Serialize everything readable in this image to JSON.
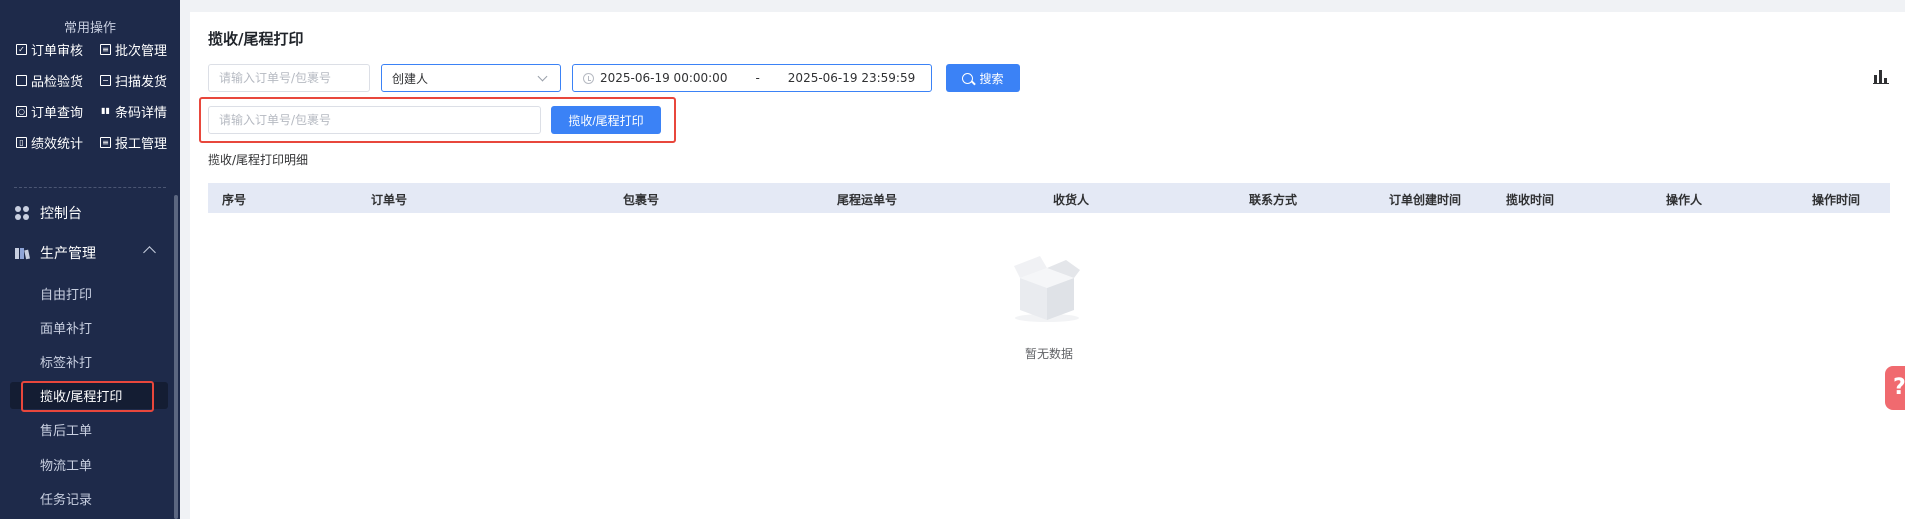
{
  "sidebar": {
    "quick_title": "常用操作",
    "quick_items": [
      {
        "label": "订单审核",
        "icon": "check-square-icon"
      },
      {
        "label": "批次管理",
        "icon": "batch-icon"
      },
      {
        "label": "品检验货",
        "icon": "inspect-icon"
      },
      {
        "label": "扫描发货",
        "icon": "scan-icon"
      },
      {
        "label": "订单查询",
        "icon": "order-query-icon"
      },
      {
        "label": "条码详情",
        "icon": "barcode-icon"
      },
      {
        "label": "绩效统计",
        "icon": "stats-icon"
      },
      {
        "label": "报工管理",
        "icon": "report-icon"
      }
    ],
    "console_label": "控制台",
    "production_label": "生产管理",
    "sub_items": [
      {
        "label": "自由打印"
      },
      {
        "label": "面单补打"
      },
      {
        "label": "标签补打"
      },
      {
        "label": "揽收/尾程打印"
      },
      {
        "label": "售后工单"
      },
      {
        "label": "物流工单"
      },
      {
        "label": "任务记录"
      }
    ]
  },
  "main": {
    "title": "揽收/尾程打印",
    "filters": {
      "order_input_placeholder": "请输入订单号/包裹号",
      "creator_value": "创建人",
      "date_start": "2025-06-19 00:00:00",
      "date_sep": "-",
      "date_end": "2025-06-19 23:59:59",
      "search_label": "搜索"
    },
    "print_input_placeholder": "请输入订单号/包裹号",
    "print_button_label": "揽收/尾程打印",
    "section_label": "揽收/尾程打印明细",
    "table_headers": [
      "序号",
      "订单号",
      "包裹号",
      "尾程运单号",
      "收货人",
      "联系方式",
      "订单创建时间",
      "揽收时间",
      "操作人",
      "操作时间"
    ],
    "empty_text": "暂无数据",
    "help_glyph": "?"
  },
  "colors": {
    "sidebar_bg": "#1e2a4a",
    "accent": "#3b82f6",
    "highlight": "#e8473c",
    "help": "#f06a6f"
  }
}
